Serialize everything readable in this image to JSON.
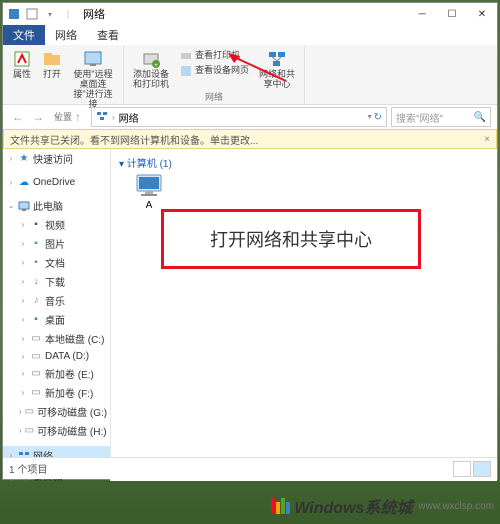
{
  "titlebar": {
    "title": "网络"
  },
  "tabs": {
    "file": "文件",
    "network": "网络",
    "view": "查看"
  },
  "ribbon": {
    "group1": {
      "properties": "属性",
      "open": "打开",
      "remote": "使用\"远程桌面连接\"进行连接",
      "label": "位置"
    },
    "group2": {
      "add_device": "添加设备和打印机",
      "view_printers": "查看打印机",
      "view_device_page": "查看设备网页",
      "label": "网络"
    },
    "group3": {
      "network_center": "网络和共享中心"
    }
  },
  "breadcrumb": {
    "root": "网络"
  },
  "search": {
    "placeholder": "搜索\"网络\""
  },
  "infobar": {
    "text": "文件共享已关闭。看不到网络计算机和设备。单击更改..."
  },
  "nav": {
    "quick_access": "快速访问",
    "onedrive": "OneDrive",
    "this_pc": "此电脑",
    "videos": "视频",
    "pictures": "图片",
    "documents": "文档",
    "downloads": "下载",
    "music": "音乐",
    "desktop": "桌面",
    "disk_c": "本地磁盘 (C:)",
    "disk_d": "DATA (D:)",
    "disk_e": "新加卷 (E:)",
    "disk_f": "新加卷 (F:)",
    "disk_g": "可移动磁盘 (G:)",
    "disk_h": "可移动磁盘 (H:)",
    "network": "网络",
    "homegroup": "家庭组"
  },
  "main": {
    "group_computers": "▾ 计算机 (1)",
    "item_a": "A"
  },
  "callout": {
    "text": "打开网络和共享中心"
  },
  "statusbar": {
    "count": "1 个项目"
  },
  "watermark": {
    "brand": "Windows系统城",
    "site": "www.wxclsp.com"
  }
}
